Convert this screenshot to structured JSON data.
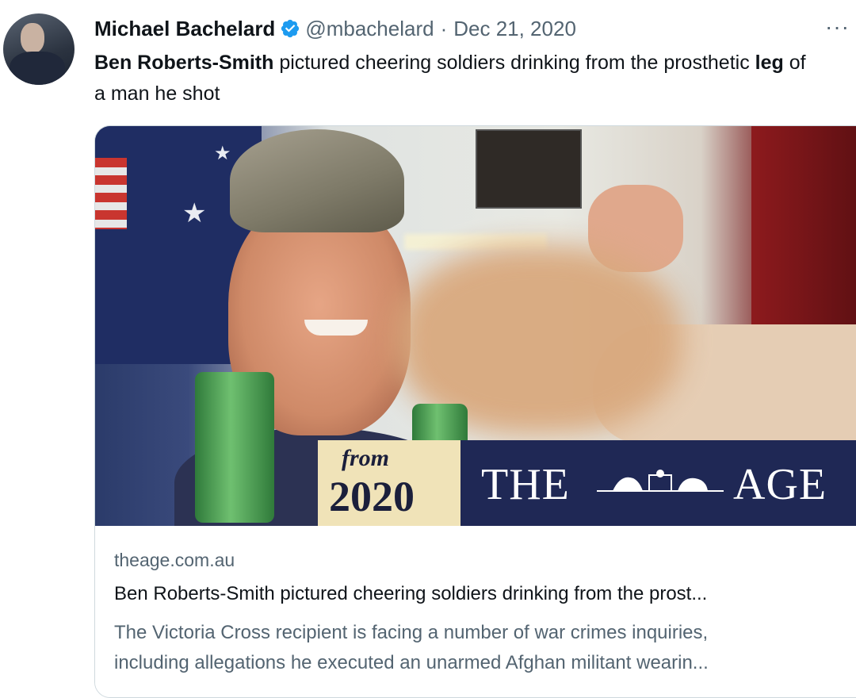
{
  "tweet": {
    "author_name": "Michael Bachelard",
    "handle": "@mbachelard",
    "separator": "·",
    "date": "Dec 21, 2020",
    "more_label": "···",
    "text_bold_1": "Ben Roberts-Smith",
    "text_part_1": " pictured cheering soldiers drinking from the prosthetic ",
    "text_bold_2": "leg",
    "text_part_2": " of a man he shot"
  },
  "card": {
    "image": {
      "badge_from": "from",
      "badge_year": "2020",
      "masthead_left": "THE",
      "masthead_right": "AGE"
    },
    "domain": "theage.com.au",
    "title": "Ben Roberts-Smith pictured cheering soldiers drinking from the prost...",
    "description_line_1": "The Victoria Cross recipient is facing a number of war crimes inquiries,",
    "description_line_2": "including allegations he executed an unarmed Afghan militant wearin..."
  },
  "colors": {
    "verified": "#1d9bf0",
    "secondary_text": "#536471",
    "masthead_bg": "#1f2855",
    "badge_bg": "#f0e3b8"
  },
  "icons": {
    "verified": "verified-badge-icon",
    "more": "more-options-icon"
  }
}
